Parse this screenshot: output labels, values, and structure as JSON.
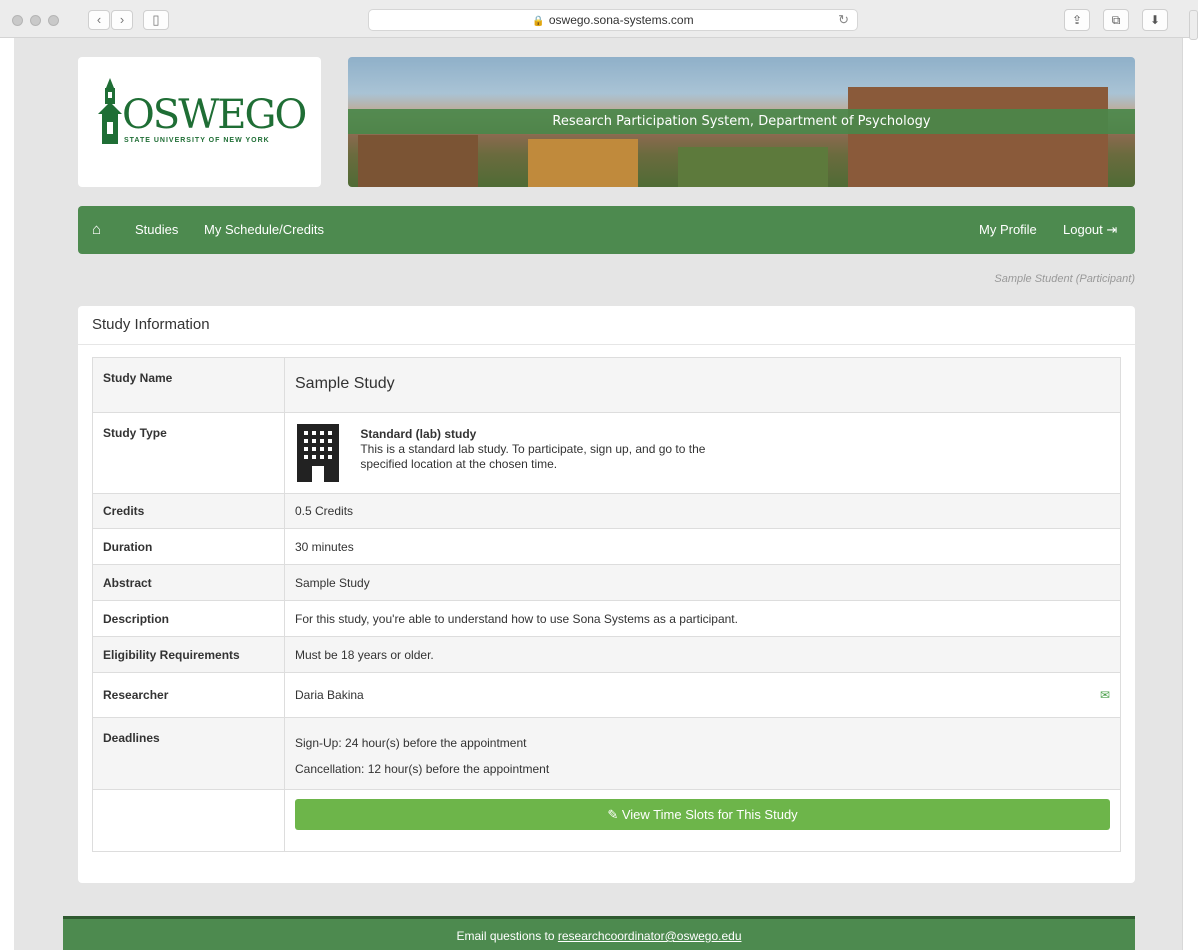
{
  "browser": {
    "url": "oswego.sona-systems.com"
  },
  "logo": {
    "name": "OSWEGO",
    "subtitle": "STATE UNIVERSITY OF NEW YORK"
  },
  "banner": {
    "title": "Research Participation System, Department of Psychology"
  },
  "nav": {
    "studies": "Studies",
    "schedule": "My Schedule/Credits",
    "profile": "My Profile",
    "logout": "Logout"
  },
  "user_line": "Sample Student (Participant)",
  "panel": {
    "title": "Study Information"
  },
  "study": {
    "labels": {
      "name": "Study Name",
      "type": "Study Type",
      "credits": "Credits",
      "duration": "Duration",
      "abstract": "Abstract",
      "description": "Description",
      "eligibility": "Eligibility Requirements",
      "researcher": "Researcher",
      "deadlines": "Deadlines"
    },
    "name": "Sample Study",
    "type_title": "Standard (lab) study",
    "type_desc_1": "This is a standard lab study. To participate, sign up, and go to the",
    "type_desc_2": "specified location at the chosen time.",
    "credits": "0.5 Credits",
    "duration": "30 minutes",
    "abstract": "Sample Study",
    "description": "For this study, you're able to understand how to use Sona Systems as a participant.",
    "eligibility": "Must be 18 years or older.",
    "researcher": "Daria Bakina",
    "deadline_signup": "Sign-Up:  24 hour(s) before the appointment",
    "deadline_cancel": "Cancellation:  12 hour(s) before the appointment"
  },
  "button": {
    "view_slots": "View Time Slots for This Study"
  },
  "footer": {
    "prefix": "Email questions to ",
    "email": "researchcoordinator@oswego.edu"
  },
  "colors": {
    "nav_green": "#4d8a4f",
    "button_green": "#6db54a",
    "logo_green": "#1f6e35"
  }
}
